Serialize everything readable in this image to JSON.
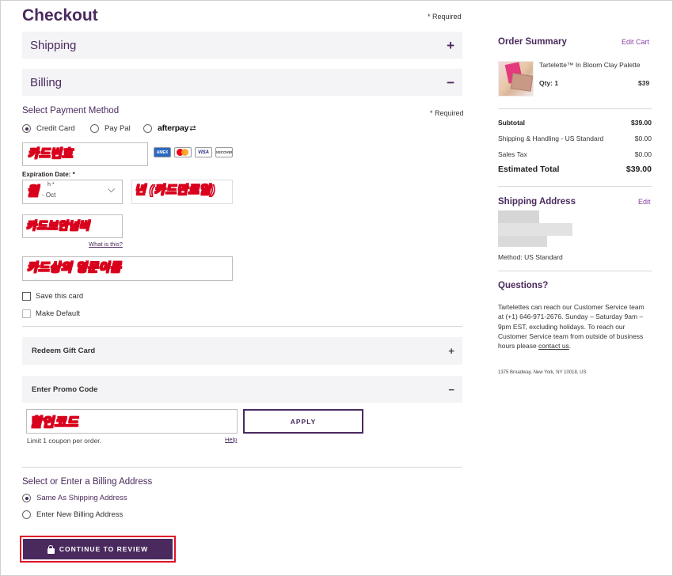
{
  "page": {
    "title": "Checkout",
    "required_note": "* Required"
  },
  "shipping_section": {
    "label": "Shipping",
    "toggle": "+"
  },
  "billing_section": {
    "label": "Billing",
    "toggle": "−"
  },
  "payment": {
    "heading": "Select Payment Method",
    "required_note": "* Required",
    "methods": [
      {
        "label": "Credit Card",
        "selected": true
      },
      {
        "label": "Pay Pal",
        "selected": false
      },
      {
        "label": "afterpay",
        "selected": false
      }
    ],
    "card_number_annotation": "카드번호",
    "card_brands": [
      "AMEX",
      "MasterCard",
      "VISA",
      "DISCOVER"
    ],
    "expiration_label": "Expiration Date:  *",
    "month_small_label": "h *",
    "month_value": "- Oct",
    "month_annotation": "월",
    "year_annotation": "년 (카드만료일)",
    "cvv_annotation": "카드보안넘버",
    "what_is_this": "What is this?",
    "name_annotation": "카드상의 영문이름",
    "save_card_label": "Save this card",
    "make_default_label": "Make Default"
  },
  "gift_card": {
    "label": "Redeem Gift Card",
    "toggle": "+"
  },
  "promo": {
    "label": "Enter Promo Code",
    "toggle": "−",
    "code_annotation": "할인코드",
    "apply_label": "APPLY",
    "limit_note": "Limit 1 coupon per order.",
    "help_label": "Help"
  },
  "billing_address": {
    "heading": "Select or Enter a Billing Address",
    "options": [
      {
        "label": "Same As Shipping Address",
        "selected": true
      },
      {
        "label": "Enter New Billing Address",
        "selected": false
      }
    ]
  },
  "cta": {
    "label": "CONTINUE TO REVIEW"
  },
  "summary": {
    "heading": "Order Summary",
    "edit_cart": "Edit Cart",
    "item_name": "Tartelette™ In Bloom Clay Palette",
    "qty_label": "Qty: 1",
    "item_price": "$39",
    "rows": [
      {
        "label": "Subtotal",
        "value": "$39.00"
      },
      {
        "label": "Shipping & Handling - US Standard",
        "value": "$0.00"
      },
      {
        "label": "Sales Tax",
        "value": "$0.00"
      },
      {
        "label": "Estimated Total",
        "value": "$39.00"
      }
    ]
  },
  "shipping_address": {
    "heading": "Shipping Address",
    "edit": "Edit",
    "method": "Method: US Standard"
  },
  "questions": {
    "heading": "Questions?",
    "text": "Tartelettes can reach our Customer Service team at (+1) 646-971-2676. Sunday – Saturday 9am – 9pm EST, excluding holidays. To reach our Customer Service team from outside of business hours please ",
    "link": "contact us",
    "text_end": ".",
    "address": "1375 Broadway, New York, NY 10018, US"
  },
  "colors": {
    "brand": "#4a2a5e",
    "link": "#8a3fa8",
    "highlight": "#e0102a"
  }
}
